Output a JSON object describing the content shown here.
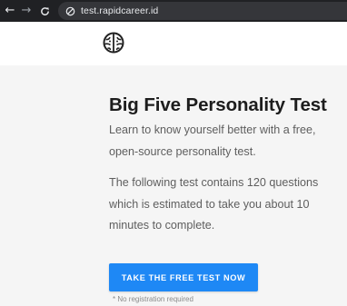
{
  "browser": {
    "url": "test.rapidcareer.id",
    "back_icon": "arrow-left-icon",
    "forward_icon": "arrow-right-icon",
    "reload_icon": "reload-icon",
    "site_icon": "site-settings-icon",
    "bar_color": "#202124"
  },
  "header": {
    "logo_icon": "brain-icon"
  },
  "hero": {
    "title": "Big Five Personality Test",
    "intro": "Learn to know yourself better with a free, open-source personality test.",
    "details": "The following test contains 120 questions which is estimated to take you about 10 minutes to complete.",
    "cta_label": "TAKE THE FREE TEST NOW",
    "cta_note": "* No registration required",
    "cta_color": "#1e88f5",
    "background_color": "#f5f5f5"
  }
}
